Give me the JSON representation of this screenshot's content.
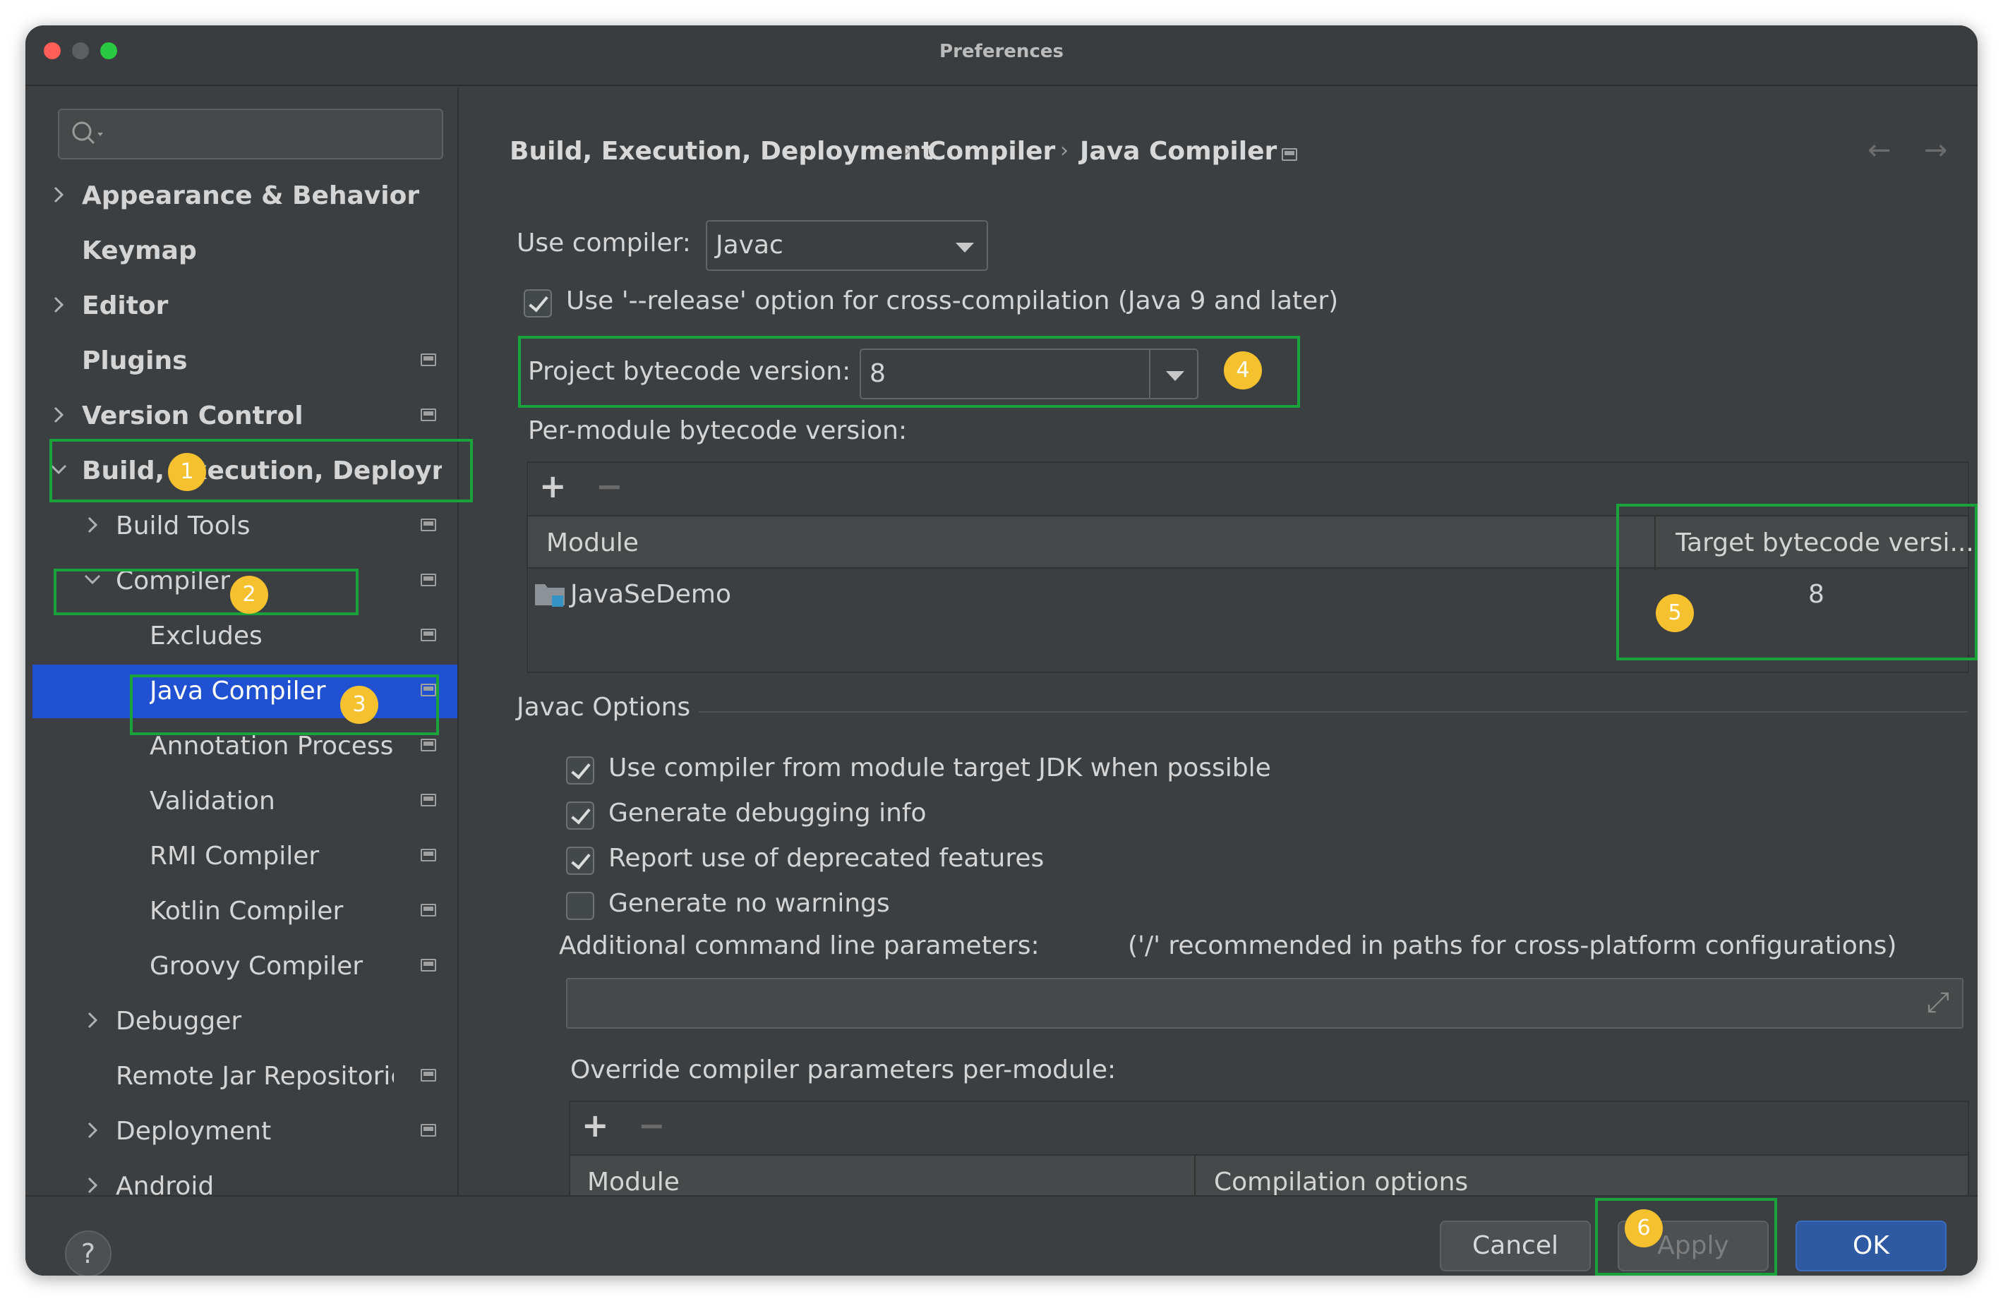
{
  "window": {
    "title": "Preferences"
  },
  "sidebar": {
    "items": [
      {
        "label": "Appearance & Behavior",
        "bold": true,
        "chevron": ">"
      },
      {
        "label": "Keymap",
        "bold": true
      },
      {
        "label": "Editor",
        "bold": true,
        "chevron": ">"
      },
      {
        "label": "Plugins",
        "bold": true,
        "scope": true
      },
      {
        "label": "Version Control",
        "bold": true,
        "chevron": ">",
        "scope": true
      },
      {
        "label": "Build, Execution, Deploym",
        "bold": true,
        "chevron": "v"
      },
      {
        "label": "Build Tools",
        "chevron": ">",
        "scope": true
      },
      {
        "label": "Compiler",
        "chevron": "v",
        "scope": true
      },
      {
        "label": "Excludes",
        "scope": true
      },
      {
        "label": "Java Compiler",
        "selected": true,
        "scope": true
      },
      {
        "label": "Annotation Processors",
        "scope": true
      },
      {
        "label": "Validation",
        "scope": true
      },
      {
        "label": "RMI Compiler",
        "scope": true
      },
      {
        "label": "Kotlin Compiler",
        "scope": true
      },
      {
        "label": "Groovy Compiler",
        "scope": true
      },
      {
        "label": "Debugger",
        "chevron": ">"
      },
      {
        "label": "Remote Jar Repositories",
        "scope": true
      },
      {
        "label": "Deployment",
        "chevron": ">",
        "scope": true
      },
      {
        "label": "Android",
        "chevron": ">"
      }
    ]
  },
  "breadcrumb": {
    "items": [
      "Build, Execution, Deployment",
      "Compiler",
      "Java Compiler"
    ],
    "separator": "›",
    "back_icon": "←",
    "forward_icon": "→"
  },
  "compiler": {
    "use_compiler_label": "Use compiler:",
    "use_compiler_value": "Javac",
    "release_option_label": "Use '--release' option for cross-compilation (Java 9 and later)",
    "release_option_checked": true,
    "project_bytecode_label": "Project bytecode version:",
    "project_bytecode_value": "8",
    "per_module_label": "Per-module bytecode version:",
    "add_icon": "+",
    "remove_icon": "−",
    "module_table": {
      "columns": [
        "Module",
        "Target bytecode versi..."
      ],
      "rows": [
        {
          "module": "JavaSeDemo",
          "target": "8"
        }
      ]
    }
  },
  "javac": {
    "section_title": "Javac Options",
    "options": [
      {
        "label": "Use compiler from module target JDK when possible",
        "checked": true
      },
      {
        "label": "Generate debugging info",
        "checked": true
      },
      {
        "label": "Report use of deprecated features",
        "checked": true
      },
      {
        "label": "Generate no warnings",
        "checked": false
      }
    ],
    "additional_params_label": "Additional command line parameters:",
    "additional_params_hint": "('/' recommended in paths for cross-platform configurations)",
    "additional_params_value": "",
    "expand_icon": "⤢",
    "override_label": "Override compiler parameters per-module:",
    "override_table": {
      "columns": [
        "Module",
        "Compilation options"
      ]
    }
  },
  "badges": [
    "1",
    "2",
    "3",
    "4",
    "5",
    "6"
  ],
  "footer": {
    "help_label": "?",
    "cancel_label": "Cancel",
    "apply_label": "Apply",
    "ok_label": "OK"
  },
  "colors": {
    "highlight_box": "#1aa33a",
    "badge": "#f6c12f",
    "selection": "#2151d3"
  }
}
